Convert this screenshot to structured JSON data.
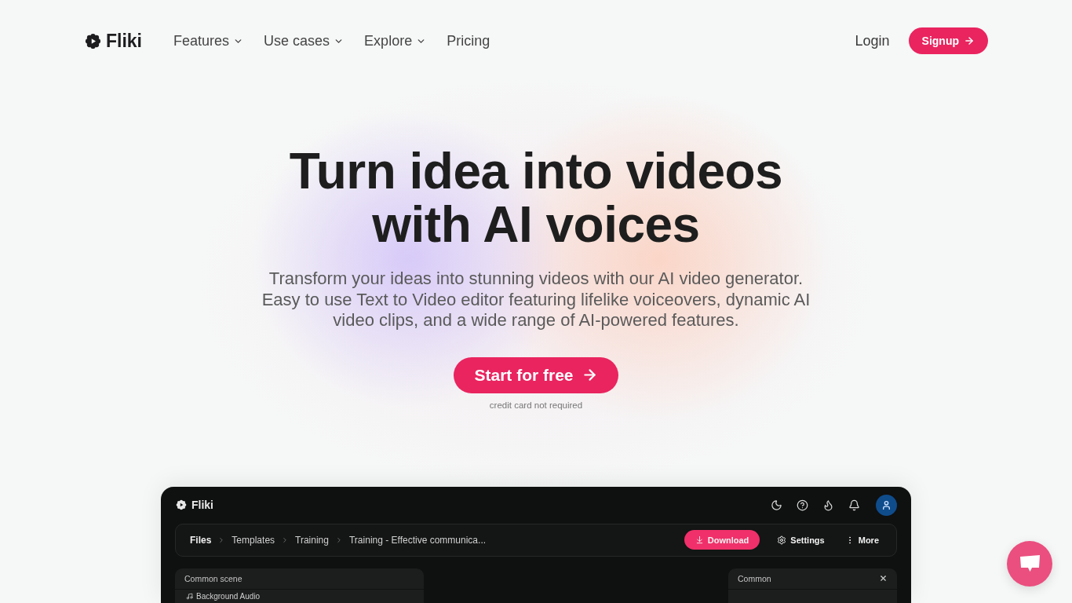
{
  "nav": {
    "logo": "Fliki",
    "items": [
      {
        "label": "Features",
        "kind": "dropdown"
      },
      {
        "label": "Use cases",
        "kind": "dropdown"
      },
      {
        "label": "Explore",
        "kind": "dropdown"
      },
      {
        "label": "Pricing",
        "kind": "link"
      }
    ],
    "login": "Login",
    "signup": "Signup"
  },
  "hero": {
    "title": "Turn idea into videos with AI voices",
    "subtitle": "Transform your ideas into stunning videos with our AI video generator. Easy to use Text to Video editor featuring lifelike voiceovers, dynamic AI video clips, and a wide range of AI-powered features.",
    "cta": "Start for free",
    "note": "credit card not required"
  },
  "app_preview": {
    "logo": "Fliki",
    "breadcrumbs": [
      "Files",
      "Templates",
      "Training",
      "Training - Effective communica..."
    ],
    "actions": [
      {
        "label": "Download",
        "kind": "primary"
      },
      {
        "label": "Settings",
        "kind": "settings"
      },
      {
        "label": "More",
        "kind": "more"
      }
    ],
    "left_panel": {
      "title": "Common scene",
      "rows": [
        "Background Audio"
      ]
    },
    "right_panel": {
      "title": "Common"
    }
  }
}
